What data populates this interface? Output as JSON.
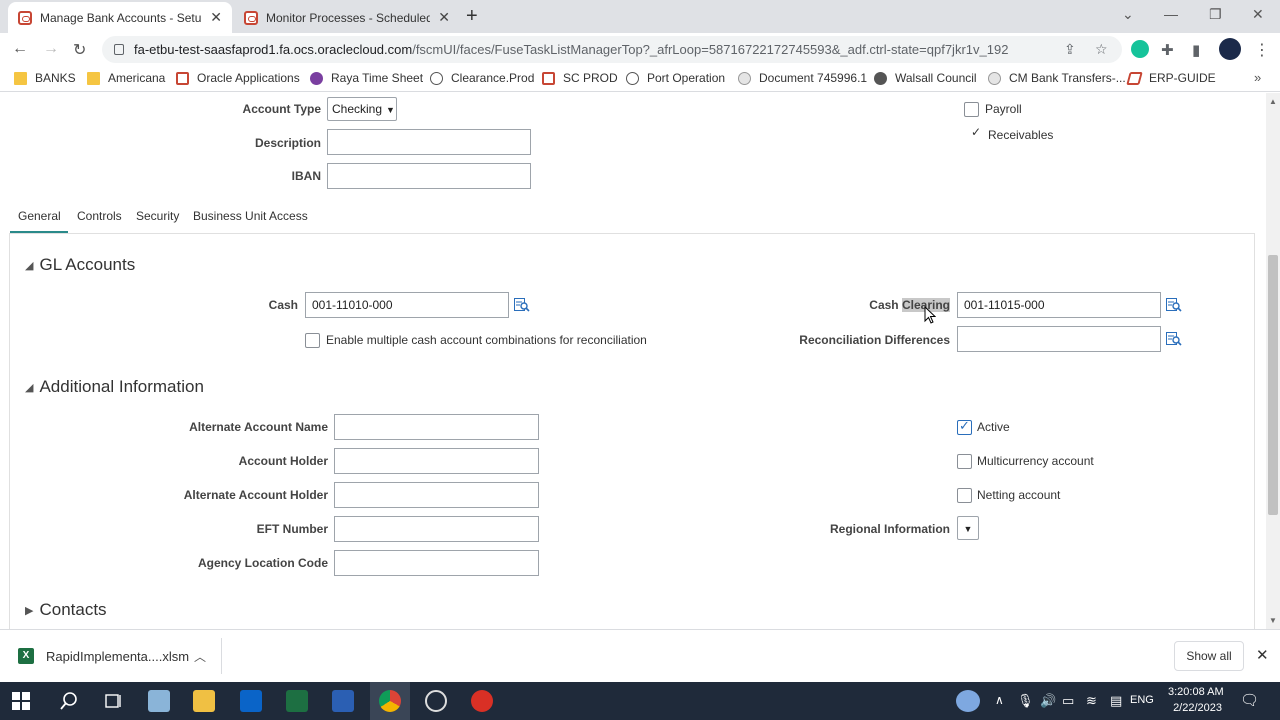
{
  "browser": {
    "tabs": [
      {
        "title": "Manage Bank Accounts - Setup a",
        "active": true
      },
      {
        "title": "Monitor Processes - Scheduled P",
        "active": false
      }
    ],
    "url_host": "fa-etbu-test-saasfaprod1.fa.ocs.oraclecloud.com",
    "url_path": "/fscmUI/faces/FuseTaskListManagerTop?_afrLoop=58716722172745593&_adf.ctrl-state=qpf7jkr1v_192",
    "bookmarks": [
      "BANKS",
      "Americana",
      "Oracle Applications",
      "Raya Time Sheet",
      "Clearance.Prod",
      "SC PROD",
      "Port Operation",
      "Document 745996.1",
      "Walsall Council",
      "CM Bank Transfers-...",
      "ERP-GUIDE"
    ]
  },
  "form_top": {
    "account_type_label": "Account Type",
    "account_type_value": "Checking",
    "description_label": "Description",
    "description_value": "",
    "iban_label": "IBAN",
    "iban_value": "",
    "payroll_label": "Payroll",
    "receivables_label": "Receivables"
  },
  "page_tabs": [
    "General",
    "Controls",
    "Security",
    "Business Unit Access"
  ],
  "gl_accounts": {
    "title": "GL Accounts",
    "cash_label": "Cash",
    "cash_value": "001-11010-000",
    "multiple_label": "Enable multiple cash account combinations for reconciliation",
    "cash_clearing_label_1": "Cash",
    "cash_clearing_label_2": "Clearing",
    "cash_clearing_value": "001-11015-000",
    "recon_diff_label": "Reconciliation Differences",
    "recon_diff_value": ""
  },
  "additional_info": {
    "title": "Additional Information",
    "alt_account_name_label": "Alternate Account Name",
    "account_holder_label": "Account Holder",
    "alt_account_holder_label": "Alternate Account Holder",
    "eft_number_label": "EFT Number",
    "agency_location_label": "Agency Location Code",
    "active_label": "Active",
    "active_checked": true,
    "multicurrency_label": "Multicurrency account",
    "netting_label": "Netting account",
    "regional_info_label": "Regional Information"
  },
  "contacts": {
    "title": "Contacts"
  },
  "download_bar": {
    "file_name": "RapidImplementa....xlsm",
    "show_all": "Show all"
  },
  "taskbar": {
    "language": "ENG",
    "time": "3:20:08 AM",
    "date": "2/22/2023"
  }
}
